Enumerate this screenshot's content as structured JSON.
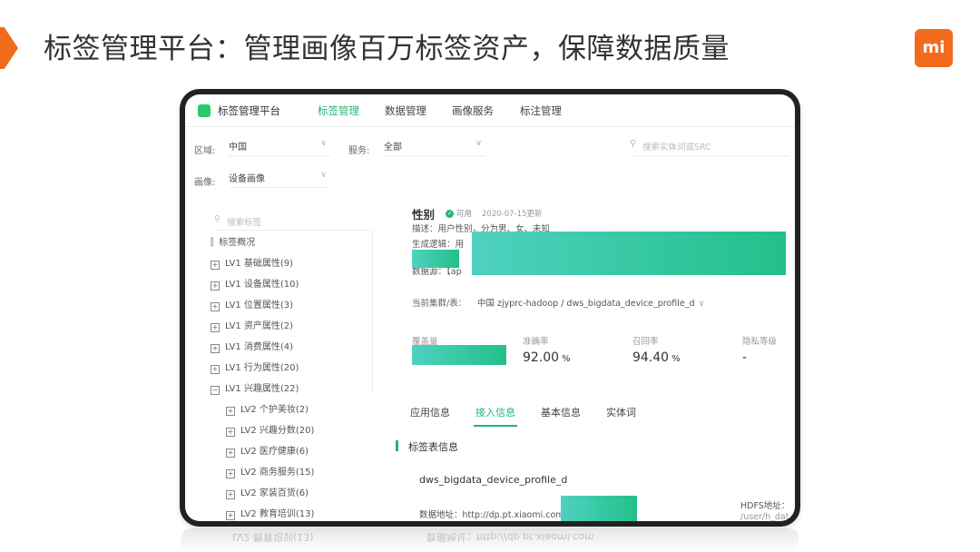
{
  "slide": {
    "title": "标签管理平台：管理画像百万标签资产，保障数据质量",
    "logo_text": "mi",
    "accent_color": "#f26b1d"
  },
  "app": {
    "name": "标签管理平台",
    "nav": [
      "标签管理",
      "数据管理",
      "画像服务",
      "标注管理"
    ],
    "active_nav": "标签管理",
    "brand_color": "#22b573"
  },
  "filters": {
    "region_label": "区域:",
    "region_value": "中国",
    "service_label": "服务:",
    "service_value": "全部",
    "portrait_label": "画像:",
    "portrait_value": "设备画像",
    "search_placeholder": "搜索实体词或SRC"
  },
  "tree": {
    "search_placeholder": "搜索标签",
    "overview": "标签概况",
    "items": [
      {
        "label": "LV1 基础属性(9)",
        "expanded": false
      },
      {
        "label": "LV1 设备属性(10)",
        "expanded": false
      },
      {
        "label": "LV1 位置属性(3)",
        "expanded": false
      },
      {
        "label": "LV1 资产属性(2)",
        "expanded": false
      },
      {
        "label": "LV1 消费属性(4)",
        "expanded": false
      },
      {
        "label": "LV1 行为属性(20)",
        "expanded": false
      },
      {
        "label": "LV1 兴趣属性(22)",
        "expanded": true
      }
    ],
    "subitems": [
      "LV2 个护美妆(2)",
      "LV2 兴趣分数(20)",
      "LV2 医疗健康(6)",
      "LV2 商务服务(15)",
      "LV2 家装百货(6)",
      "LV2 教育培训(13)"
    ]
  },
  "detail": {
    "title": "性别",
    "status": "可用",
    "updated": "2020-07-15更新",
    "description": "描述：用户性别，分为男、女、未知",
    "logic_prefix": "生成逻辑：用",
    "source_prefix": "数据源：【ap",
    "cluster_label": "当前集群/表：",
    "cluster_value": "中国 zjyprc-hadoop / dws_bigdata_device_profile_d",
    "metrics": [
      {
        "label": "覆盖量",
        "value": "",
        "unit": ""
      },
      {
        "label": "准确率",
        "value": "92.00",
        "unit": "%"
      },
      {
        "label": "召回率",
        "value": "94.40",
        "unit": "%"
      },
      {
        "label": "隐私等级",
        "value": "-",
        "unit": ""
      }
    ],
    "tabs": [
      "应用信息",
      "接入信息",
      "基本信息",
      "实体词"
    ],
    "active_tab": "接入信息",
    "section_title": "标签表信息",
    "table_name": "dws_bigdata_device_profile_d",
    "data_address": "数据地址：http://dp.pt.xiaomi.com",
    "hdfs_label": "HDFS地址：",
    "hdfs_value": "/user/h_dat"
  },
  "reflection": {
    "left_text": "LV2 教育培训(13)",
    "right_text": "数据地址：http://dp.pt.xiaomi.com"
  }
}
